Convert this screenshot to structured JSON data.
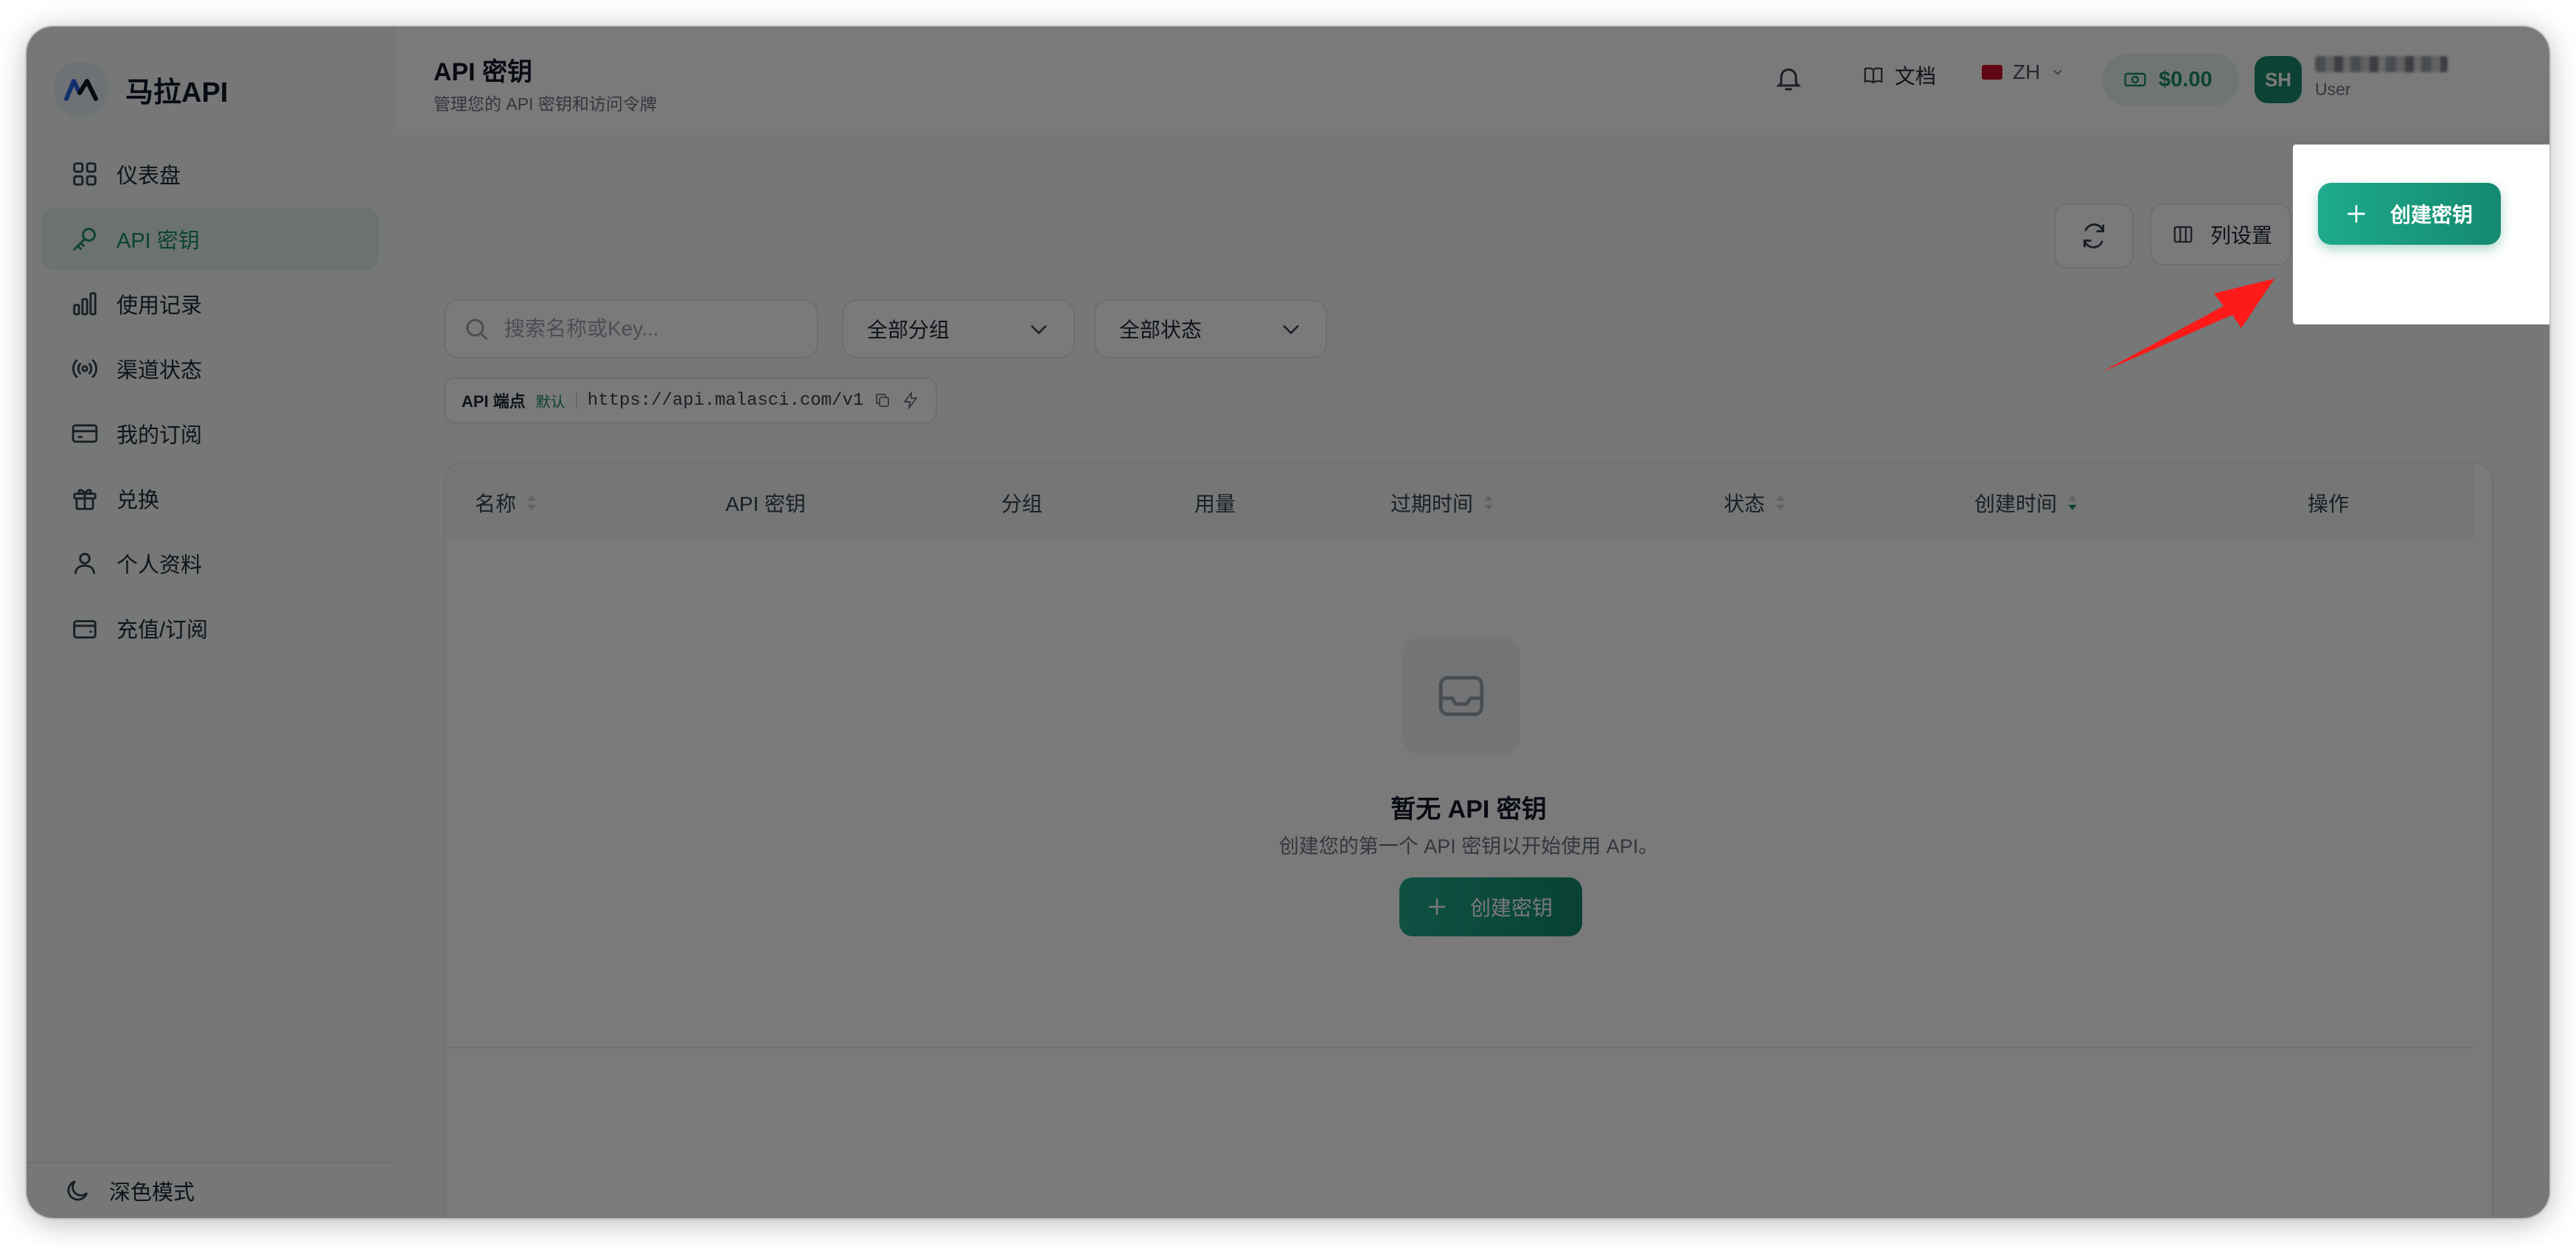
{
  "brand": {
    "name": "马拉API"
  },
  "sidebar": {
    "items": [
      {
        "label": "仪表盘",
        "icon": "dashboard-icon"
      },
      {
        "label": "API 密钥",
        "icon": "key-icon",
        "active": true
      },
      {
        "label": "使用记录",
        "icon": "bar-chart-icon"
      },
      {
        "label": "渠道状态",
        "icon": "broadcast-icon"
      },
      {
        "label": "我的订阅",
        "icon": "card-icon"
      },
      {
        "label": "兑换",
        "icon": "gift-icon"
      },
      {
        "label": "个人资料",
        "icon": "user-icon"
      },
      {
        "label": "充值/订阅",
        "icon": "wallet-icon"
      }
    ],
    "footer": {
      "label": "深色模式",
      "icon": "moon-icon"
    }
  },
  "header": {
    "title": "API 密钥",
    "subtitle": "管理您的 API 密钥和访问令牌",
    "docs_label": "文档",
    "language": "ZH",
    "balance": "$0.00",
    "avatar_initials": "SH",
    "user_role": "User"
  },
  "toolbar": {
    "columns_label": "列设置",
    "create_label": "创建密钥"
  },
  "filters": {
    "search_placeholder": "搜索名称或Key...",
    "group_value": "全部分组",
    "status_value": "全部状态"
  },
  "endpoint": {
    "label": "API 端点",
    "default_tag": "默认",
    "url": "https://api.malasci.com/v1"
  },
  "table": {
    "columns": [
      "名称",
      "API 密钥",
      "分组",
      "用量",
      "过期时间",
      "状态",
      "创建时间",
      "操作"
    ]
  },
  "empty_state": {
    "title": "暂无 API 密钥",
    "subtitle": "创建您的第一个 API 密钥以开始使用 API。",
    "button_label": "创建密钥"
  },
  "colors": {
    "accent": "#1a8a6b",
    "annotation_arrow": "#ff1a1a"
  }
}
